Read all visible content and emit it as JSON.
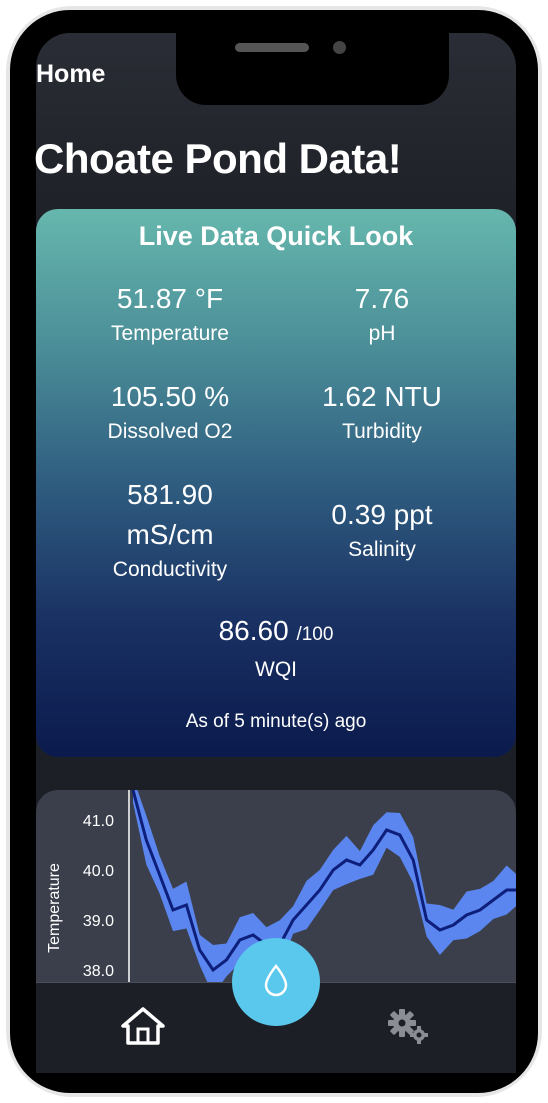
{
  "header": {
    "nav_title": "Home",
    "page_title": "Choate Pond Data!"
  },
  "live_card": {
    "title": "Live Data Quick Look",
    "metrics": {
      "temperature": {
        "value": "51.87 °F",
        "label": "Temperature"
      },
      "ph": {
        "value": "7.76",
        "label": "pH"
      },
      "dissolved_o2": {
        "value": "105.50 %",
        "label": "Dissolved O2"
      },
      "turbidity": {
        "value": "1.62 NTU",
        "label": "Turbidity"
      },
      "conductivity": {
        "value": "581.90 mS/cm",
        "label": "Conductivity"
      },
      "salinity": {
        "value": "0.39 ppt",
        "label": "Salinity"
      },
      "wqi": {
        "value": "86.60",
        "suffix": "/100",
        "label": "WQI"
      }
    },
    "as_of": "As of 5 minute(s) ago",
    "gradient_top": "#66b7ad",
    "gradient_bottom": "#0b1a4d"
  },
  "chart_data": {
    "type": "line",
    "ylabel": "Temperature",
    "yticks": [
      "41.0",
      "40.0",
      "39.0",
      "38.0"
    ],
    "ylim": [
      37.8,
      41.4
    ],
    "line_color": "#0d1f7a",
    "band_color": "#5b86f0",
    "series": [
      {
        "values": [
          41.6,
          40.6,
          39.9,
          39.2,
          39.3,
          38.4,
          38.0,
          38.2,
          38.6,
          38.7,
          38.5,
          38.5,
          39.0,
          39.3,
          39.6,
          40.0,
          40.2,
          40.1,
          40.4,
          40.8,
          40.7,
          40.2,
          39.0,
          38.8,
          38.9,
          39.1,
          39.2,
          39.4,
          39.6,
          39.6
        ]
      }
    ]
  },
  "bottom_nav": {
    "home_icon": "home-icon",
    "settings_icon": "gear-icon",
    "fab_icon": "water-drop-icon",
    "fab_color": "#5ac8ec"
  }
}
